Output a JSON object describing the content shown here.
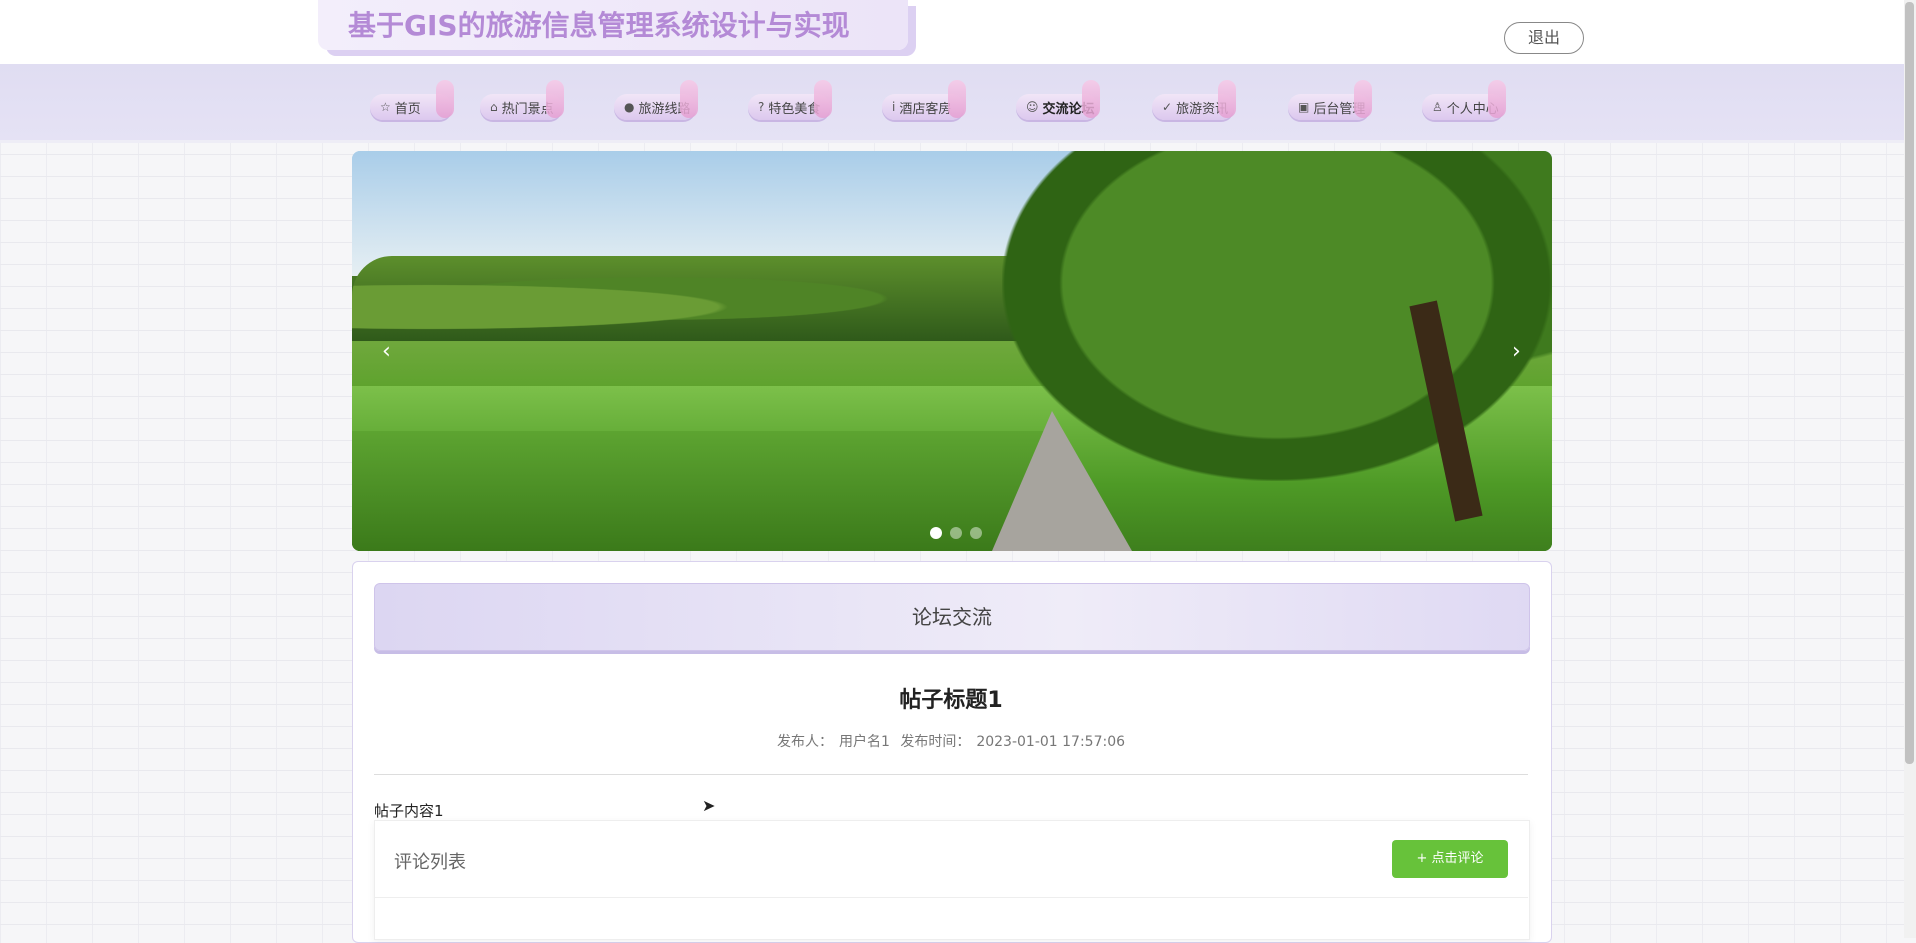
{
  "header": {
    "title": "基于GIS的旅游信息管理系统设计与实现",
    "logout_label": "退出"
  },
  "nav": {
    "items": [
      {
        "icon": "☆",
        "label": "首页"
      },
      {
        "icon": "⌂",
        "label": "热门景点"
      },
      {
        "icon": "●",
        "label": "旅游线路"
      },
      {
        "icon": "?",
        "label": "特色美食"
      },
      {
        "icon": "i",
        "label": "酒店客房"
      },
      {
        "icon": "☺",
        "label": "交流论坛"
      },
      {
        "icon": "✓",
        "label": "旅游资讯"
      },
      {
        "icon": "▣",
        "label": "后台管理"
      },
      {
        "icon": "♙",
        "label": "个人中心"
      }
    ],
    "active": "交流论坛"
  },
  "carousel": {
    "prev_icon": "‹",
    "next_icon": "›",
    "slide_count": 3,
    "active_index": 0
  },
  "forum": {
    "section_title": "论坛交流",
    "post_title": "帖子标题1",
    "author_label": "发布人：",
    "author": "用户名1",
    "time_label": "发布时间：",
    "time": "2023-01-01 17:57:06",
    "content": "帖子内容1"
  },
  "comments": {
    "heading": "评论列表",
    "add_button": "+ 点击评论",
    "button_color": "#67c23a"
  },
  "colors": {
    "title": "#b48ad6",
    "nav_band": "#e0ddf2"
  }
}
